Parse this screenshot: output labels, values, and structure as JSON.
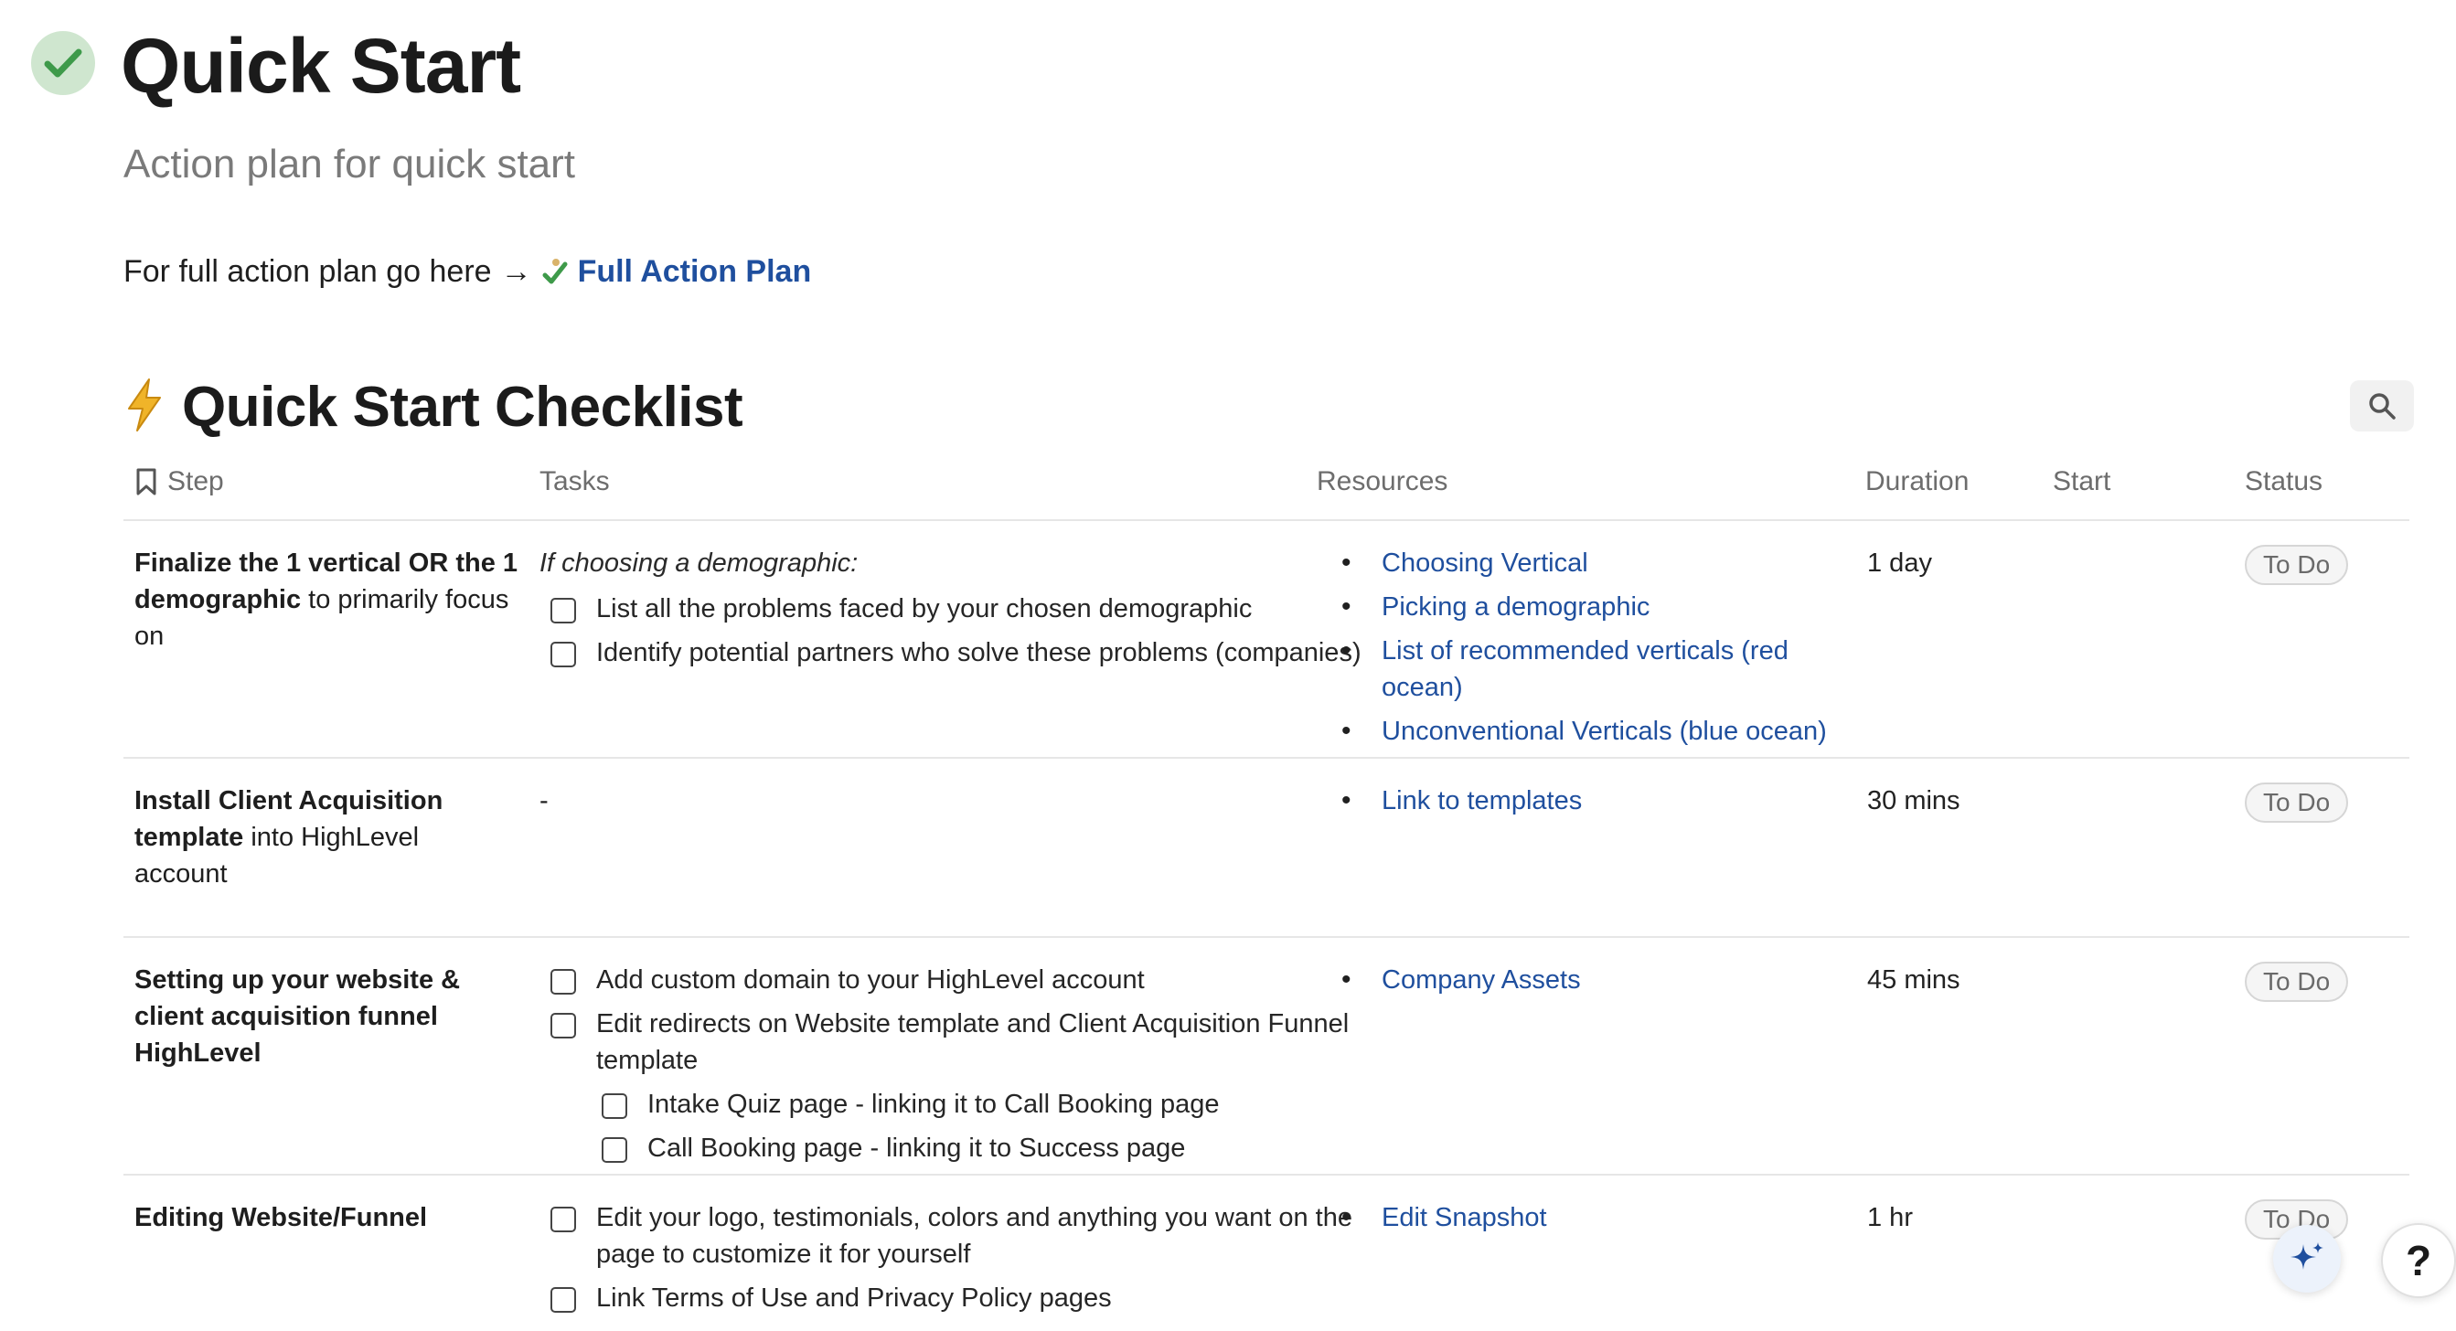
{
  "page": {
    "title": "Quick Start",
    "subtitle": "Action plan for quick start",
    "intro_text": "For full action plan go here",
    "intro_arrow": "→",
    "intro_link": "Full Action Plan"
  },
  "section": {
    "title": "Quick Start Checklist"
  },
  "table": {
    "headers": {
      "step": "Step",
      "tasks": "Tasks",
      "resources": "Resources",
      "duration": "Duration",
      "start": "Start",
      "status": "Status"
    },
    "rows": [
      {
        "step_bold": "Finalize the 1 vertical OR the 1 demographic",
        "step_rest": " to primarily focus on",
        "tasks_intro": "If choosing a demographic:",
        "tasks": [
          "List all the problems faced by your chosen demographic",
          "Identify potential partners who solve these problems (companies)"
        ],
        "resources": [
          "Choosing Vertical",
          "Picking a demographic",
          "List of recommended verticals (red ocean)",
          "Unconventional Verticals (blue ocean)"
        ],
        "duration": "1 day",
        "status": "To Do"
      },
      {
        "step_bold": "Install Client Acquisition template",
        "step_rest": " into HighLevel account",
        "tasks_text": "-",
        "resources": [
          "Link to templates"
        ],
        "duration": "30 mins",
        "status": "To Do"
      },
      {
        "step_bold": "Setting up your website & client acquisition funnel HighLevel",
        "step_rest": "",
        "tasks": [
          "Add custom domain to your HighLevel account",
          "Edit redirects on Website template and Client Acquisition Funnel template"
        ],
        "subtasks": [
          "Intake Quiz page - linking it to Call Booking page",
          "Call Booking page - linking it to Success page"
        ],
        "resources": [
          "Company Assets"
        ],
        "duration": "45 mins",
        "status": "To Do"
      },
      {
        "step_bold": "Editing Website/Funnel",
        "step_rest": "",
        "tasks": [
          "Edit your logo, testimonials, colors and anything you want on the page to customize it for yourself",
          "Link Terms of Use and Privacy Policy pages"
        ],
        "resources": [
          "Edit Snapshot"
        ],
        "duration": "1 hr",
        "status": "To Do"
      }
    ]
  },
  "help_label": "?",
  "colors": {
    "link": "#1f4f9e",
    "check_bg": "#cfe6cf",
    "check": "#3e9a4a",
    "bolt": "#f0b429"
  }
}
